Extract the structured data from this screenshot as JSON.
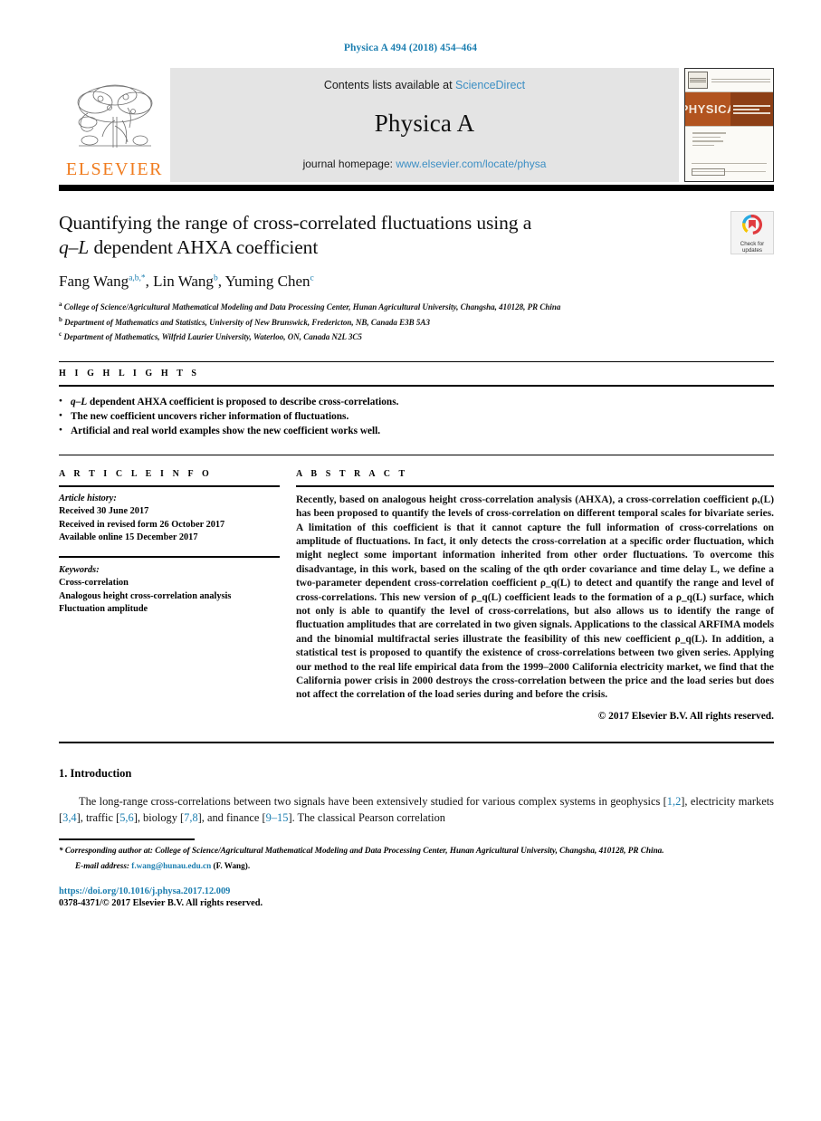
{
  "running_head": "Physica A 494 (2018) 454–464",
  "masthead": {
    "publisher": "ELSEVIER",
    "contents_prefix": "Contents lists available at ",
    "contents_link": "ScienceDirect",
    "journal_name": "Physica A",
    "homepage_prefix": "journal homepage: ",
    "homepage_link": "www.elsevier.com/locate/physa",
    "cover_title": "PHYSICA",
    "cover_subtitle": "STATISTICAL MECHANICS AND ITS APPLICATIONS"
  },
  "title": {
    "line1": "Quantifying the range of cross-correlated fluctuations using a",
    "line2_italic": "q–L",
    "line2_rest": " dependent AHXA coefficient"
  },
  "crossmark": {
    "label_line1": "Check for",
    "label_line2": "updates"
  },
  "authors": [
    {
      "name": "Fang Wang",
      "marks": "a,b,*"
    },
    {
      "name": "Lin Wang",
      "marks": "b"
    },
    {
      "name": "Yuming Chen",
      "marks": "c"
    }
  ],
  "affiliations": [
    {
      "mark": "a",
      "text": "College of Science/Agricultural Mathematical Modeling and Data Processing Center, Hunan Agricultural University, Changsha, 410128, PR China"
    },
    {
      "mark": "b",
      "text": "Department of Mathematics and Statistics, University of New Brunswick, Fredericton, NB, Canada E3B 5A3"
    },
    {
      "mark": "c",
      "text": "Department of Mathematics, Wilfrid Laurier University, Waterloo, ON, Canada N2L 3C5"
    }
  ],
  "highlights": {
    "label": "H I G H L I G H T S",
    "items": [
      {
        "italic": "q–L",
        "rest": " dependent AHXA coefficient is proposed to describe cross-correlations."
      },
      {
        "italic": "",
        "rest": "The new coefficient uncovers richer information of fluctuations."
      },
      {
        "italic": "",
        "rest": "Artificial and real world examples show the new coefficient works well."
      }
    ]
  },
  "article_info": {
    "label": "A R T I C L E    I N F O",
    "history_label": "Article history:",
    "history": [
      "Received 30 June 2017",
      "Received in revised form 26 October 2017",
      "Available online 15 December 2017"
    ],
    "keywords_label": "Keywords:",
    "keywords": [
      "Cross-correlation",
      "Analogous height cross-correlation analysis",
      "Fluctuation amplitude"
    ]
  },
  "abstract": {
    "label": "A B S T R A C T",
    "text": "Recently, based on analogous height cross-correlation analysis (AHXA), a cross-correlation coefficient ρₓ(L) has been proposed to quantify the levels of cross-correlation on different temporal scales for bivariate series. A limitation of this coefficient is that it cannot capture the full information of cross-correlations on amplitude of fluctuations. In fact, it only detects the cross-correlation at a specific order fluctuation, which might neglect some important  information inherited from other order fluctuations. To overcome this disadvantage, in this work, based on the scaling of the qth order covariance and time delay L, we define a two-parameter dependent cross-correlation coefficient ρ_q(L) to detect and quantify the range and level of cross-correlations. This new version of ρ_q(L) coefficient leads to the formation of a ρ_q(L) surface, which not only is able to quantify the level of cross-correlations, but also allows us to identify the range of fluctuation amplitudes that are correlated in two given signals. Applications to the classical ARFIMA models and the binomial multifractal series illustrate the feasibility of this new coefficient ρ_q(L). In addition, a statistical test is proposed to quantify the existence of cross-correlations between two given series. Applying our method to the real life empirical data from the 1999–2000 California electricity market, we find that the California power crisis in 2000 destroys the cross-correlation between the price and the load series but does not affect the correlation of the load series during and before the crisis.",
    "copyright": "© 2017 Elsevier B.V. All rights reserved."
  },
  "section": {
    "number_title": "1. Introduction",
    "paragraph_1a": "The long-range cross-correlations between two signals have been extensively studied for various complex systems in geophysics [",
    "ref1": "1,2",
    "paragraph_1b": "], electricity markets [",
    "ref2": "3,4",
    "paragraph_1c": "], traffic [",
    "ref3": "5,6",
    "paragraph_1d": "], biology [",
    "ref4": "7,8",
    "paragraph_1e": "], and finance [",
    "ref5": "9–15",
    "paragraph_1f": "]. The classical Pearson correlation"
  },
  "footnotes": {
    "corresponding": "* Corresponding author at: College of Science/Agricultural Mathematical Modeling and Data Processing Center, Hunan Agricultural University, Changsha, 410128, PR China.",
    "email_label": "E-mail address:",
    "email": "f.wang@hunau.edu.cn",
    "email_suffix": "(F. Wang).",
    "doi": "https://doi.org/10.1016/j.physa.2017.12.009",
    "issn": "0378-4371/© 2017 Elsevier B.V. All rights reserved."
  },
  "colors": {
    "link": "#1b7eb0",
    "elsevier_orange": "#f07c1f",
    "masthead_gray": "#e4e4e4",
    "crossmark_red": "#e03a3e"
  }
}
